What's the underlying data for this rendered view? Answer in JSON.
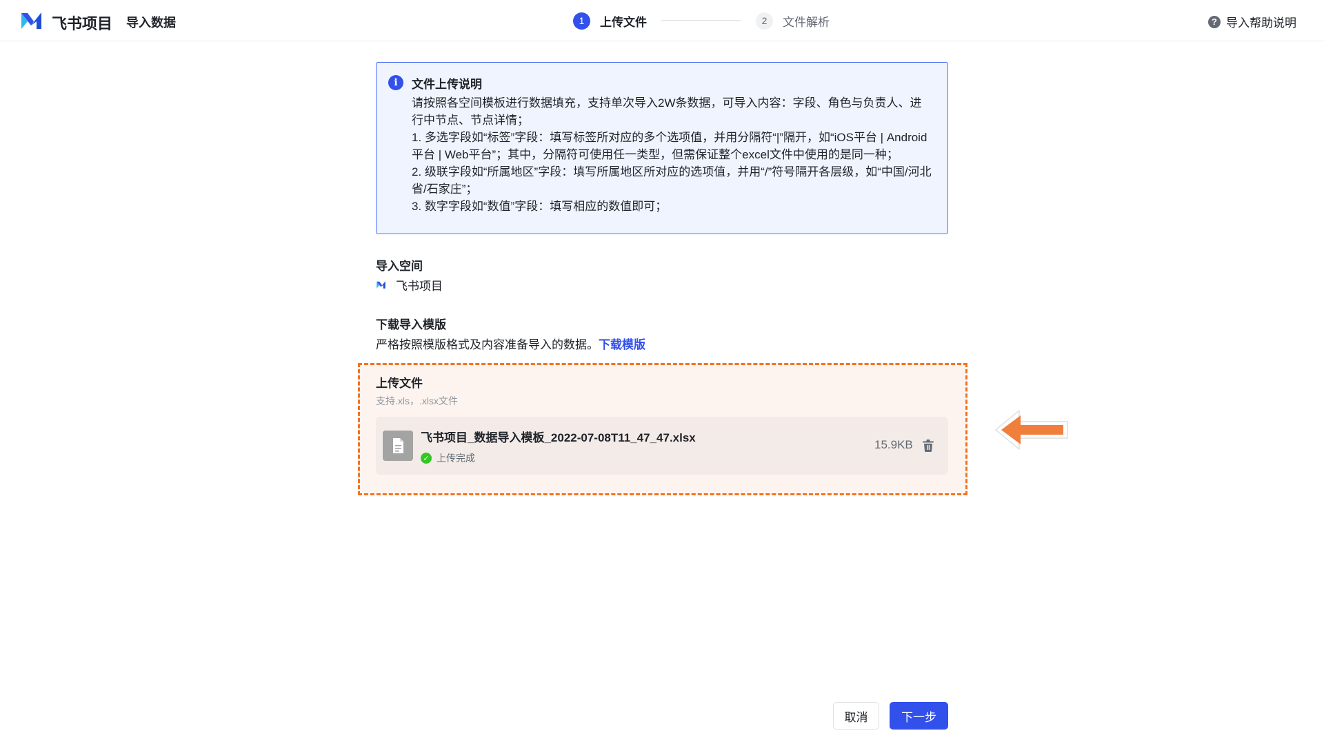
{
  "header": {
    "app_name": "飞书项目",
    "page_name": "导入数据",
    "steps": [
      {
        "num": "1",
        "label": "上传文件"
      },
      {
        "num": "2",
        "label": "文件解析"
      }
    ],
    "help": {
      "icon": "?",
      "label": "导入帮助说明"
    }
  },
  "info": {
    "icon": "i",
    "title": "文件上传说明",
    "lines": [
      "请按照各空间模板进行数据填充，支持单次导入2W条数据，可导入内容：字段、角色与负责人、进行中节点、节点详情；",
      "1. 多选字段如“标签”字段：填写标签所对应的多个选项值，并用分隔符“|”隔开，如“iOS平台 | Android平台 | Web平台”；其中，分隔符可使用任一类型，但需保证整个excel文件中使用的是同一种；",
      "2. 级联字段如“所属地区”字段：填写所属地区所对应的选项值，并用“/”符号隔开各层级，如“中国/河北省/石家庄”；",
      "3. 数字字段如“数值”字段：填写相应的数值即可；"
    ]
  },
  "space": {
    "title": "导入空间",
    "name": "飞书项目"
  },
  "template": {
    "title": "下载导入模版",
    "desc": "严格按照模版格式及内容准备导入的数据。",
    "link": "下载模版"
  },
  "upload": {
    "title": "上传文件",
    "subtitle": "支持.xls，.xlsx文件",
    "file": {
      "name": "飞书项目_数据导入模板_2022-07-08T11_47_47.xlsx",
      "status": "上传完成",
      "size": "15.9KB"
    }
  },
  "footer": {
    "cancel": "取消",
    "next": "下一步"
  },
  "colors": {
    "primary": "#3250eb",
    "highlight_border": "#f5731f",
    "arrow": "#f07f3c",
    "success": "#34c724"
  }
}
